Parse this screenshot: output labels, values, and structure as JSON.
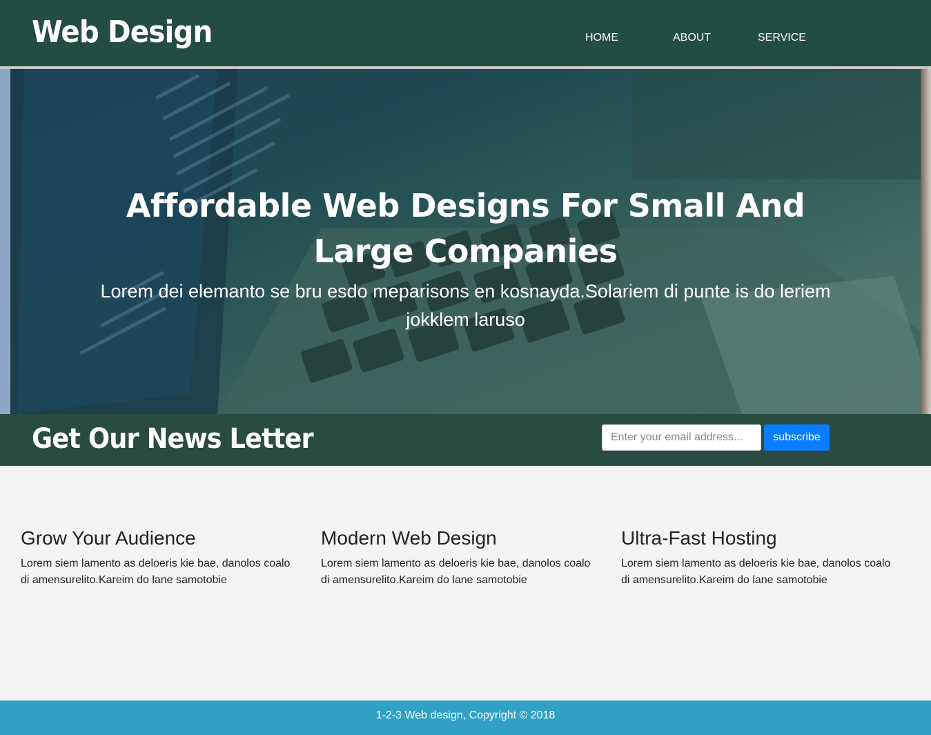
{
  "header": {
    "logo": "Web Design",
    "nav": [
      {
        "label": "HOME"
      },
      {
        "label": "ABOUT"
      },
      {
        "label": "SERVICE"
      }
    ]
  },
  "hero": {
    "title": "Affordable Web Designs For Small And Large Companies",
    "subtitle": "Lorem dei elemanto se bru esdo meparisons en kosnayda.Solariem di punte is do leriem jokklem laruso"
  },
  "newsletter": {
    "title": "Get Our News Letter",
    "email_placeholder": "Enter your email address...",
    "button_label": "subscribe"
  },
  "features": [
    {
      "title": "Grow Your Audience",
      "text": "Lorem siem lamento as deloeris kie bae, danolos coalo di amensurelito.Kareim do lane samotobie"
    },
    {
      "title": "Modern Web Design",
      "text": "Lorem siem lamento as deloeris kie bae, danolos coalo di amensurelito.Kareim do lane samotobie"
    },
    {
      "title": "Ultra-Fast Hosting",
      "text": "Lorem siem lamento as deloeris kie bae, danolos coalo di amensurelito.Kareim do lane samotobie"
    }
  ],
  "footer": {
    "text": "1-2-3 Web design, Copyright © 2018"
  },
  "colors": {
    "header_bg": "#234c42",
    "newsletter_bg": "#2a4b42",
    "subscribe_button": "#0a7cff",
    "footer_bg": "#30a0c4",
    "content_bg": "#f4f4f4"
  }
}
